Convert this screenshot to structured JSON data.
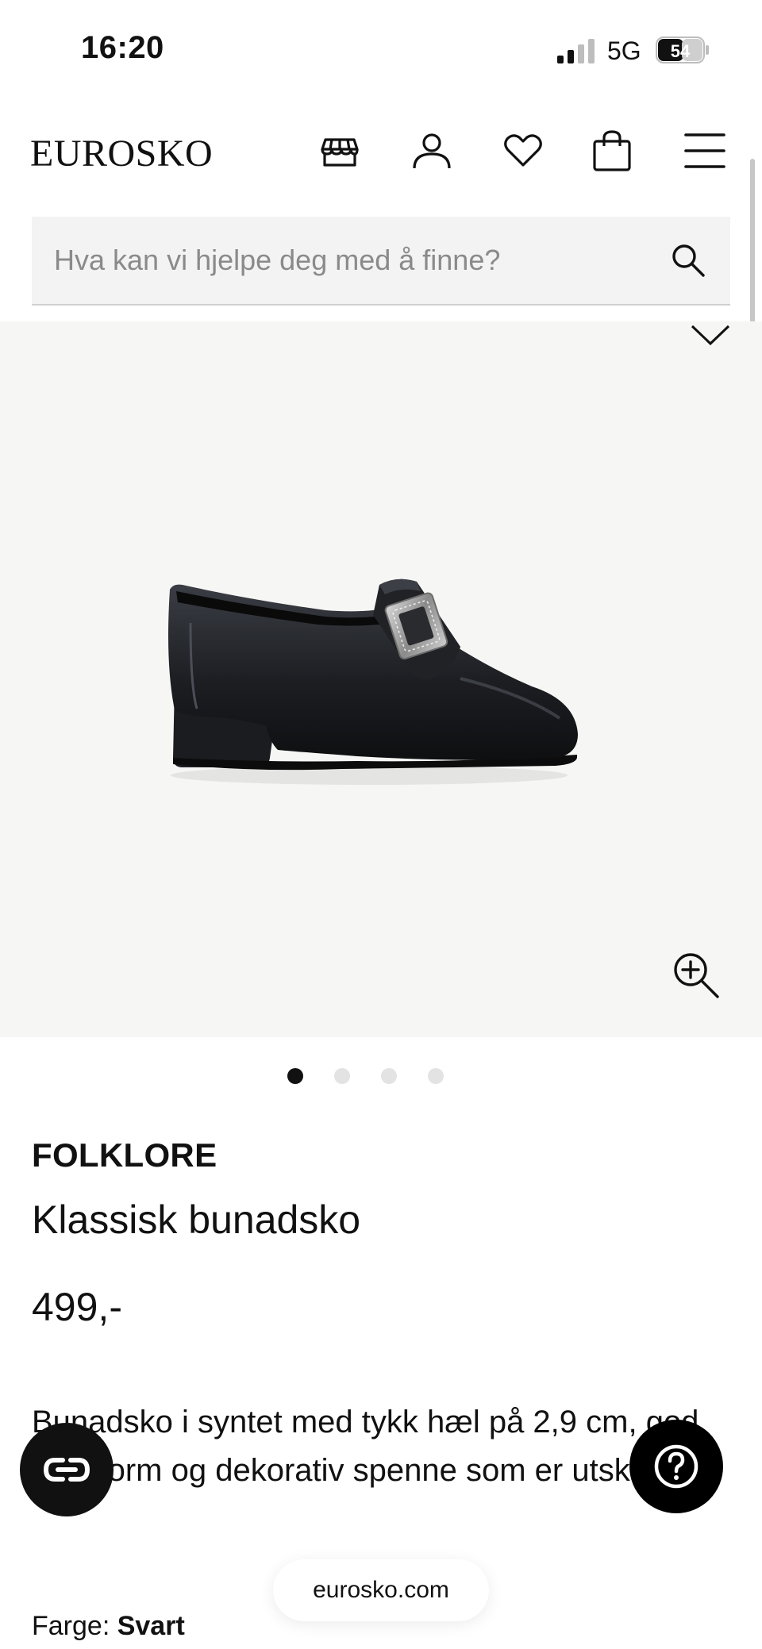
{
  "status_bar": {
    "time": "16:20",
    "network": "5G",
    "battery": "54"
  },
  "header": {
    "logo": "EUROSKO",
    "icons": [
      "store-icon",
      "user-icon",
      "heart-icon",
      "bag-icon",
      "menu-icon"
    ]
  },
  "search": {
    "placeholder": "Hva kan vi hjelpe deg med å finne?"
  },
  "gallery": {
    "image_count": 4,
    "active_index": 0
  },
  "product": {
    "brand": "FOLKLORE",
    "name": "Klassisk bunadsko",
    "price": "499,-",
    "description": "Bunadsko i syntet med tykk hæl på 2,9 cm, god passform og dekorativ spenne som er utskiftbar.",
    "color_label": "Farge:",
    "color_value": "Svart"
  },
  "browser": {
    "url": "eurosko.com"
  },
  "colors": {
    "accent": "#111111",
    "gallery_bg": "#f6f6f4",
    "search_bg": "#f3f3f3"
  }
}
